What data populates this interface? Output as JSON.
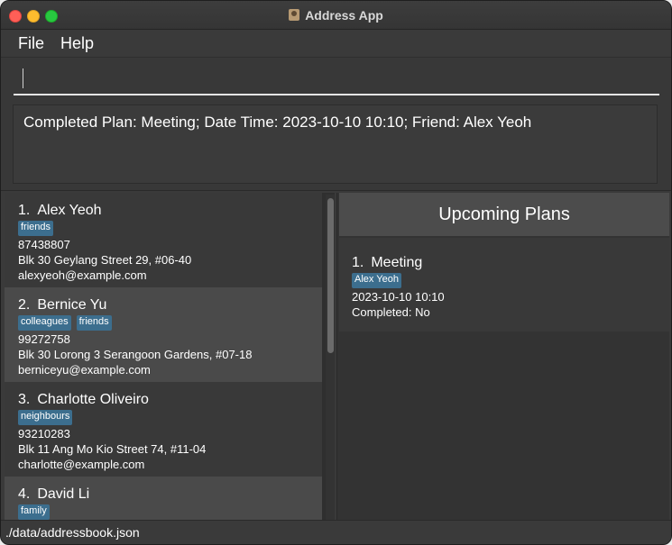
{
  "window": {
    "title": "Address App"
  },
  "menu": {
    "file": "File",
    "help": "Help"
  },
  "command": {
    "value": ""
  },
  "result": {
    "text": "Completed Plan: Meeting; Date Time: 2023-10-10 10:10; Friend: Alex Yeoh"
  },
  "persons": [
    {
      "index": "1.",
      "name": "Alex Yeoh",
      "tags": [
        "friends"
      ],
      "phone": "87438807",
      "address": "Blk 30 Geylang Street 29, #06-40",
      "email": "alexyeoh@example.com"
    },
    {
      "index": "2.",
      "name": "Bernice Yu",
      "tags": [
        "colleagues",
        "friends"
      ],
      "phone": "99272758",
      "address": "Blk 30 Lorong 3 Serangoon Gardens, #07-18",
      "email": "berniceyu@example.com"
    },
    {
      "index": "3.",
      "name": "Charlotte Oliveiro",
      "tags": [
        "neighbours"
      ],
      "phone": "93210283",
      "address": "Blk 11 Ang Mo Kio Street 74, #11-04",
      "email": "charlotte@example.com"
    },
    {
      "index": "4.",
      "name": "David Li",
      "tags": [
        "family"
      ]
    }
  ],
  "plans": {
    "header": "Upcoming Plans",
    "items": [
      {
        "index": "1.",
        "name": "Meeting",
        "friend": "Alex Yeoh",
        "datetime": "2023-10-10 10:10",
        "completed": "Completed: No"
      }
    ]
  },
  "status": {
    "path": "./data/addressbook.json"
  }
}
